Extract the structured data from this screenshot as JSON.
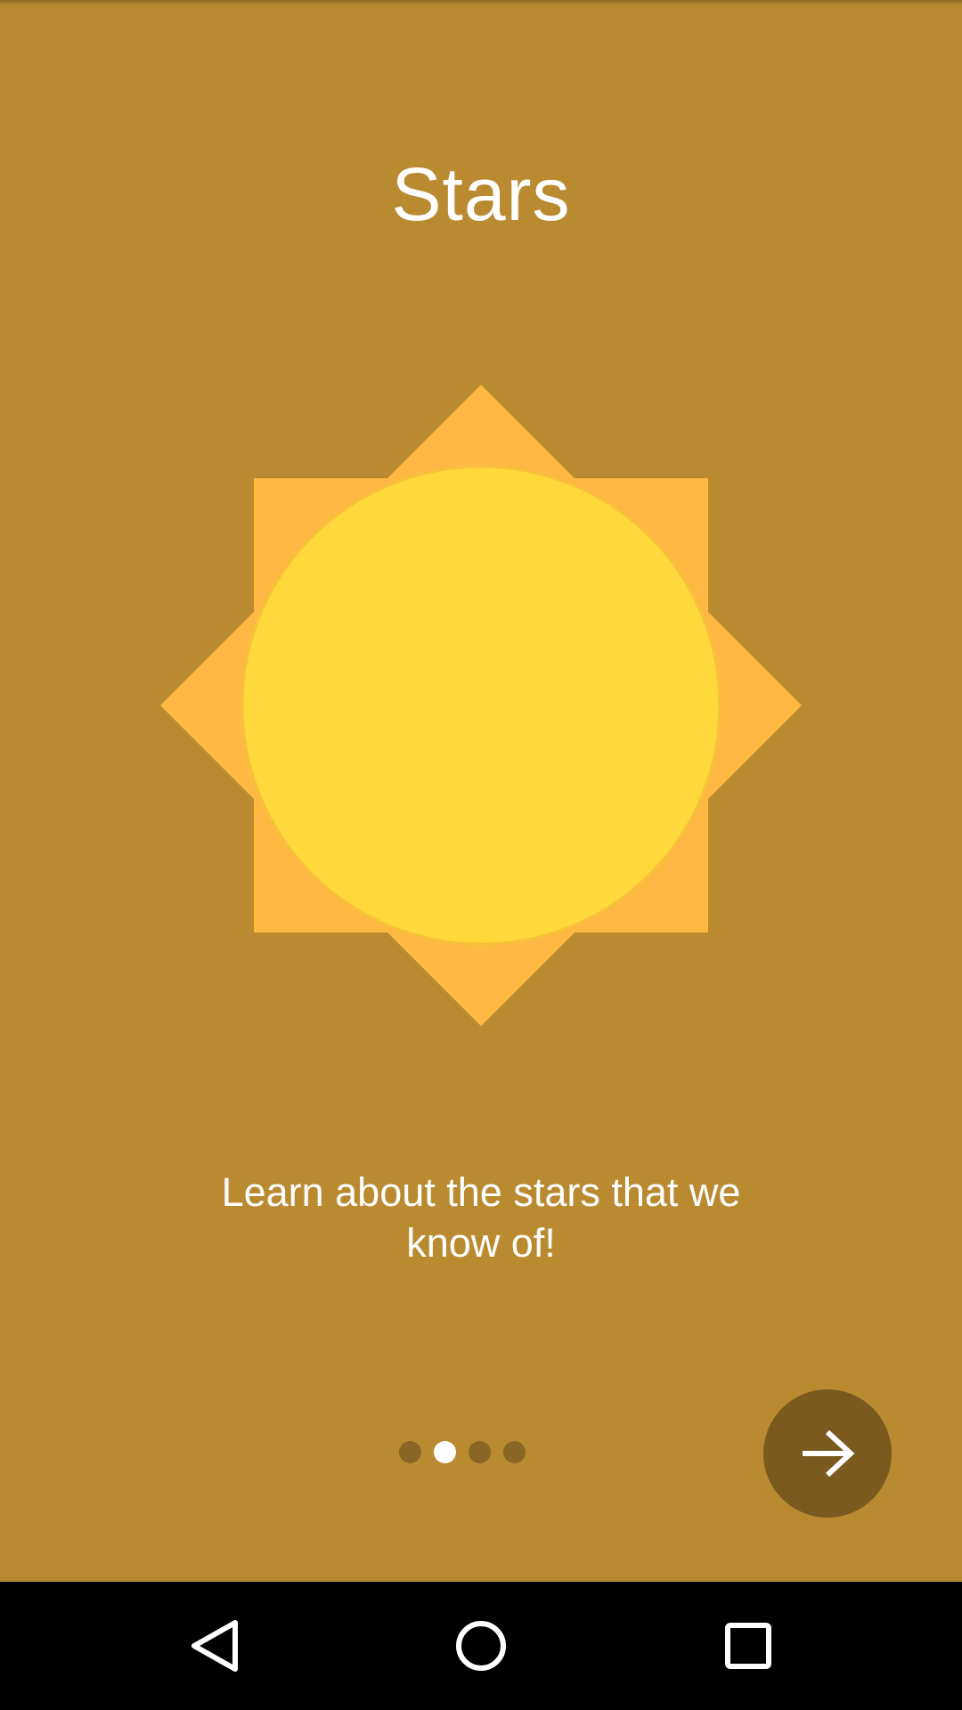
{
  "onboarding": {
    "title": "Stars",
    "description_line1": "Learn about the stars that we",
    "description_line2": "know of!",
    "illustration_icon": "sun-icon",
    "page_indicator": {
      "total_pages": 4,
      "current_page": 2
    },
    "next_button_icon": "arrow-right-icon"
  },
  "colors": {
    "background": "#ba8a31",
    "sun_rays": "#ffb841",
    "sun_core": "#ffd83b",
    "dot_inactive": "#8a6624",
    "dot_active": "#ffffff",
    "next_button": "#7a5a1f",
    "navbar": "#000000"
  },
  "navbar": {
    "back_icon": "back-triangle-icon",
    "home_icon": "home-circle-icon",
    "recents_icon": "recents-square-icon"
  }
}
